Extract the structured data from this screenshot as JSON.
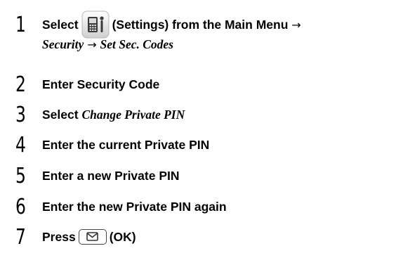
{
  "steps": [
    {
      "number": "1",
      "select": "Select",
      "icon": "settings-icon",
      "settings_paren": "(Settings) from the Main Menu",
      "arrow1": "→",
      "menu_path_1": "Security",
      "arrow2": "→",
      "menu_path_2": "Set Sec. Codes"
    },
    {
      "number": "2",
      "text": "Enter Security Code"
    },
    {
      "number": "3",
      "select": "Select",
      "option": "Change Private PIN"
    },
    {
      "number": "4",
      "text": "Enter the current Private PIN"
    },
    {
      "number": "5",
      "text": "Enter a new Private PIN"
    },
    {
      "number": "6",
      "text": "Enter the new Private PIN again"
    },
    {
      "number": "7",
      "press": "Press",
      "key_icon": "mail-key-icon",
      "key_label": "(OK)"
    }
  ]
}
